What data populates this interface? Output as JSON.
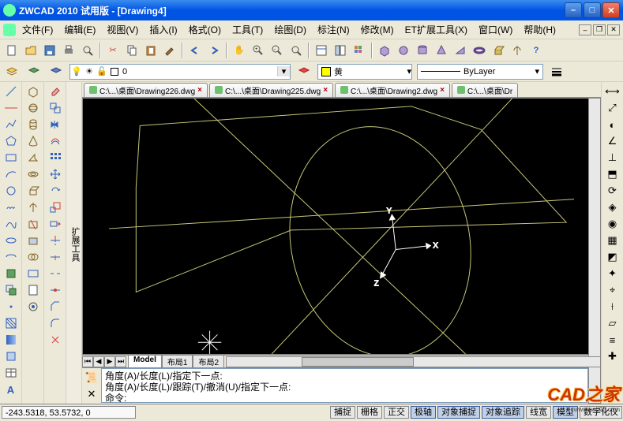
{
  "title": "ZWCAD 2010 试用版 - [Drawing4]",
  "menus": [
    "文件(F)",
    "编辑(E)",
    "视图(V)",
    "插入(I)",
    "格式(O)",
    "工具(T)",
    "绘图(D)",
    "标注(N)",
    "修改(M)",
    "ET扩展工具(X)",
    "窗口(W)",
    "帮助(H)"
  ],
  "layer": {
    "name": "0"
  },
  "color": {
    "label": "黄"
  },
  "linetype": {
    "label": "ByLayer"
  },
  "drawing_tabs": [
    {
      "label": "C:\\...\\桌面\\Drawing226.dwg"
    },
    {
      "label": "C:\\...\\桌面\\Drawing225.dwg"
    },
    {
      "label": "C:\\...\\桌面\\Drawing2.dwg"
    },
    {
      "label": "C:\\...\\桌面\\Dr"
    }
  ],
  "axis": {
    "x": "X",
    "y": "Y",
    "z": "Z"
  },
  "model_tabs": {
    "model": "Model",
    "layout1": "布局1",
    "layout2": "布局2"
  },
  "command": {
    "line1": "角度(A)/长度(L)/指定下一点:",
    "line2": "角度(A)/长度(L)/跟踪(T)/撤消(U)/指定下一点:",
    "line3": "命令:"
  },
  "coords": "-243.5318, 53.5732,  0",
  "status_buttons": [
    "捕捉",
    "栅格",
    "正交",
    "极轴",
    "对象捕捉",
    "对象追踪",
    "线宽",
    "模型",
    "数字化仪"
  ],
  "status_active": [
    3,
    4,
    5,
    7
  ],
  "watermark": {
    "big": "CAD之家",
    "small": "www.cad23.com"
  }
}
